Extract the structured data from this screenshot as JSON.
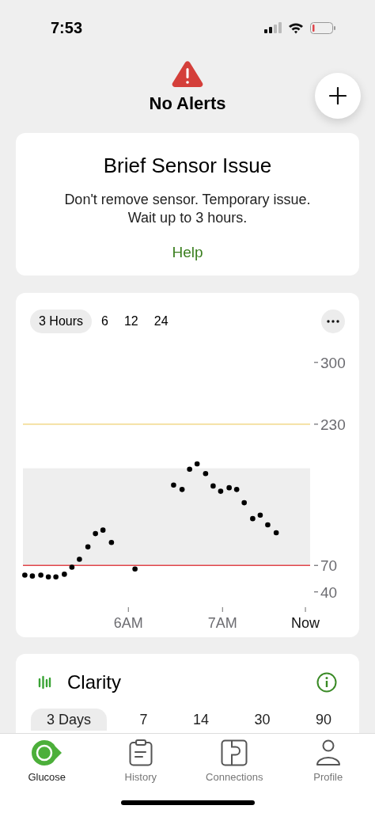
{
  "status_bar": {
    "time": "7:53"
  },
  "header": {
    "title": "No Alerts"
  },
  "alert_card": {
    "title": "Brief Sensor Issue",
    "message_lines": [
      "Don't remove sensor. Temporary issue.",
      "Wait up to 3 hours."
    ],
    "link": "Help"
  },
  "glucose_chart": {
    "ranges": [
      {
        "label": "3 Hours",
        "selected": true
      },
      {
        "label": "6",
        "selected": false
      },
      {
        "label": "12",
        "selected": false
      },
      {
        "label": "24",
        "selected": false
      }
    ],
    "chart_data": {
      "type": "scatter",
      "xlim": [
        4.88,
        7.93
      ],
      "ylim": [
        40,
        300
      ],
      "xticks": [
        {
          "value": 6,
          "label": "6AM"
        },
        {
          "value": 7,
          "label": "7AM"
        },
        {
          "value": 7.88,
          "label": "Now"
        }
      ],
      "yticks": [
        40,
        70,
        230,
        300
      ],
      "x": [
        4.9,
        4.98,
        5.07,
        5.15,
        5.23,
        5.32,
        5.4,
        5.48,
        5.57,
        5.65,
        5.73,
        5.82,
        6.07,
        6.48,
        6.57,
        6.65,
        6.73,
        6.82,
        6.9,
        6.98,
        7.07,
        7.15,
        7.23,
        7.32,
        7.4,
        7.48,
        7.57
      ],
      "series": [
        {
          "color": "#000000",
          "values": [
            59,
            58,
            59,
            57,
            57,
            60,
            68,
            77,
            91,
            106,
            110,
            96,
            66,
            161,
            156,
            179,
            185,
            174,
            160,
            154,
            158,
            156,
            141,
            123,
            127,
            116,
            107
          ]
        }
      ],
      "bands": [
        {
          "axis": "y",
          "from": 70,
          "to": 180,
          "color": "#eeeeee"
        }
      ],
      "ref_lines": [
        {
          "axis": "y",
          "value": 230,
          "color": "#f2d98a"
        },
        {
          "axis": "y",
          "value": 70,
          "color": "#e0454a"
        }
      ]
    }
  },
  "clarity": {
    "title": "Clarity",
    "ranges": [
      {
        "label": "3 Days",
        "selected": true
      },
      {
        "label": "7",
        "selected": false
      },
      {
        "label": "14",
        "selected": false
      },
      {
        "label": "30",
        "selected": false
      },
      {
        "label": "90",
        "selected": false
      }
    ]
  },
  "tab_bar": [
    {
      "label": "Glucose",
      "kind": "glucose",
      "selected": true
    },
    {
      "label": "History",
      "kind": "history",
      "selected": false
    },
    {
      "label": "Connections",
      "kind": "connections",
      "selected": false
    },
    {
      "label": "Profile",
      "kind": "profile",
      "selected": false
    }
  ]
}
